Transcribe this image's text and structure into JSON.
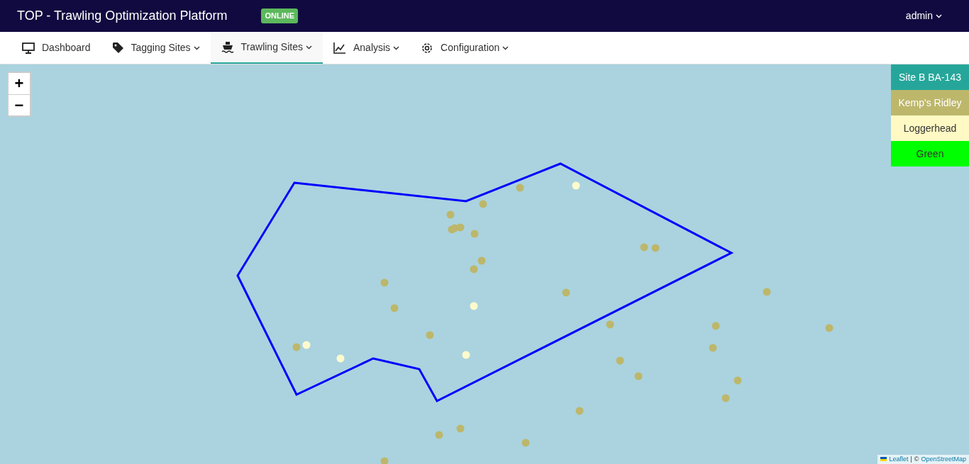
{
  "app": {
    "title": "TOP - Trawling Optimization Platform",
    "status": "ONLINE",
    "user": "admin"
  },
  "tabs": [
    {
      "label": "Dashboard",
      "dropdown": false,
      "selected": false
    },
    {
      "label": "Tagging Sites",
      "dropdown": true,
      "selected": false
    },
    {
      "label": "Trawling Sites",
      "dropdown": true,
      "selected": true
    },
    {
      "label": "Analysis",
      "dropdown": true,
      "selected": false
    },
    {
      "label": "Configuration",
      "dropdown": true,
      "selected": false
    }
  ],
  "map": {
    "zoom_in": "+",
    "zoom_out": "−",
    "legend": [
      {
        "label": "Site B BA-143",
        "color": "#26a69a"
      },
      {
        "label": "Kemp's Ridley",
        "color": "#bdb76b"
      },
      {
        "label": "Loggerhead",
        "color": "#fff9c4"
      },
      {
        "label": "Green",
        "color": "#00ff00"
      }
    ],
    "markers": [
      {
        "color": "#bdb76b"
      },
      {
        "color": "#bdb76b"
      },
      {
        "color": "#bdb76b"
      },
      {
        "color": "#bdb76b"
      },
      {
        "color": "#bdb76b"
      },
      {
        "color": "#bdb76b"
      },
      {
        "color": "#bdb76b"
      },
      {
        "color": "#bdb76b"
      },
      {
        "color": "#bdb76b"
      },
      {
        "color": "#bdb76b"
      },
      {
        "color": "#bdb76b"
      },
      {
        "color": "#bdb76b"
      },
      {
        "color": "#bdb76b"
      },
      {
        "color": "#bdb76b"
      },
      {
        "color": "#bdb76b"
      },
      {
        "color": "#bdb76b"
      },
      {
        "color": "#bdb76b"
      },
      {
        "color": "#bdb76b"
      },
      {
        "color": "#bdb76b"
      },
      {
        "color": "#bdb76b"
      },
      {
        "color": "#bdb76b"
      },
      {
        "color": "#bdb76b"
      },
      {
        "color": "#bdb76b"
      },
      {
        "color": "#bdb76b"
      },
      {
        "color": "#bdb76b"
      },
      {
        "color": "#bdb76b"
      },
      {
        "color": "#bdb76b"
      },
      {
        "color": "#bdb76b"
      },
      {
        "color": "#bdb76b"
      },
      {
        "color": "#bdb76b"
      },
      {
        "color": "#fffacd"
      },
      {
        "color": "#fffacd"
      },
      {
        "color": "#fffacd"
      },
      {
        "color": "#fffacd"
      },
      {
        "color": "#fffacd"
      }
    ],
    "attribution": {
      "leaflet": "Leaflet",
      "separator": "|",
      "copyright": "©",
      "osm": "OpenStreetMap"
    }
  }
}
